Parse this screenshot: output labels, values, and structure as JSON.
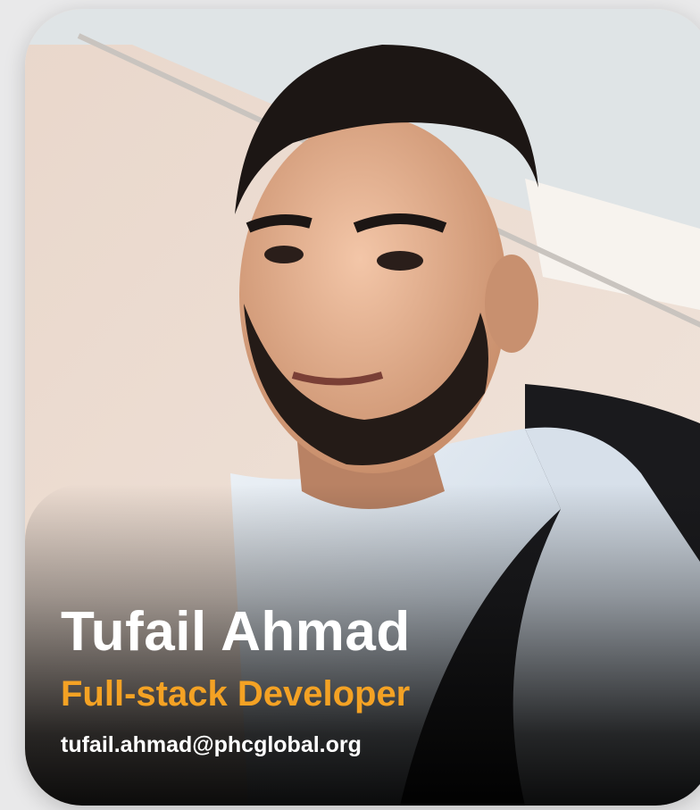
{
  "profile": {
    "name": "Tufail Ahmad",
    "role": "Full-stack Developer",
    "email": "tufail.ahmad@phcglobal.org"
  },
  "colors": {
    "role_accent": "#f4a224",
    "name_text": "#ffffff",
    "background": "#e9e9ea"
  }
}
